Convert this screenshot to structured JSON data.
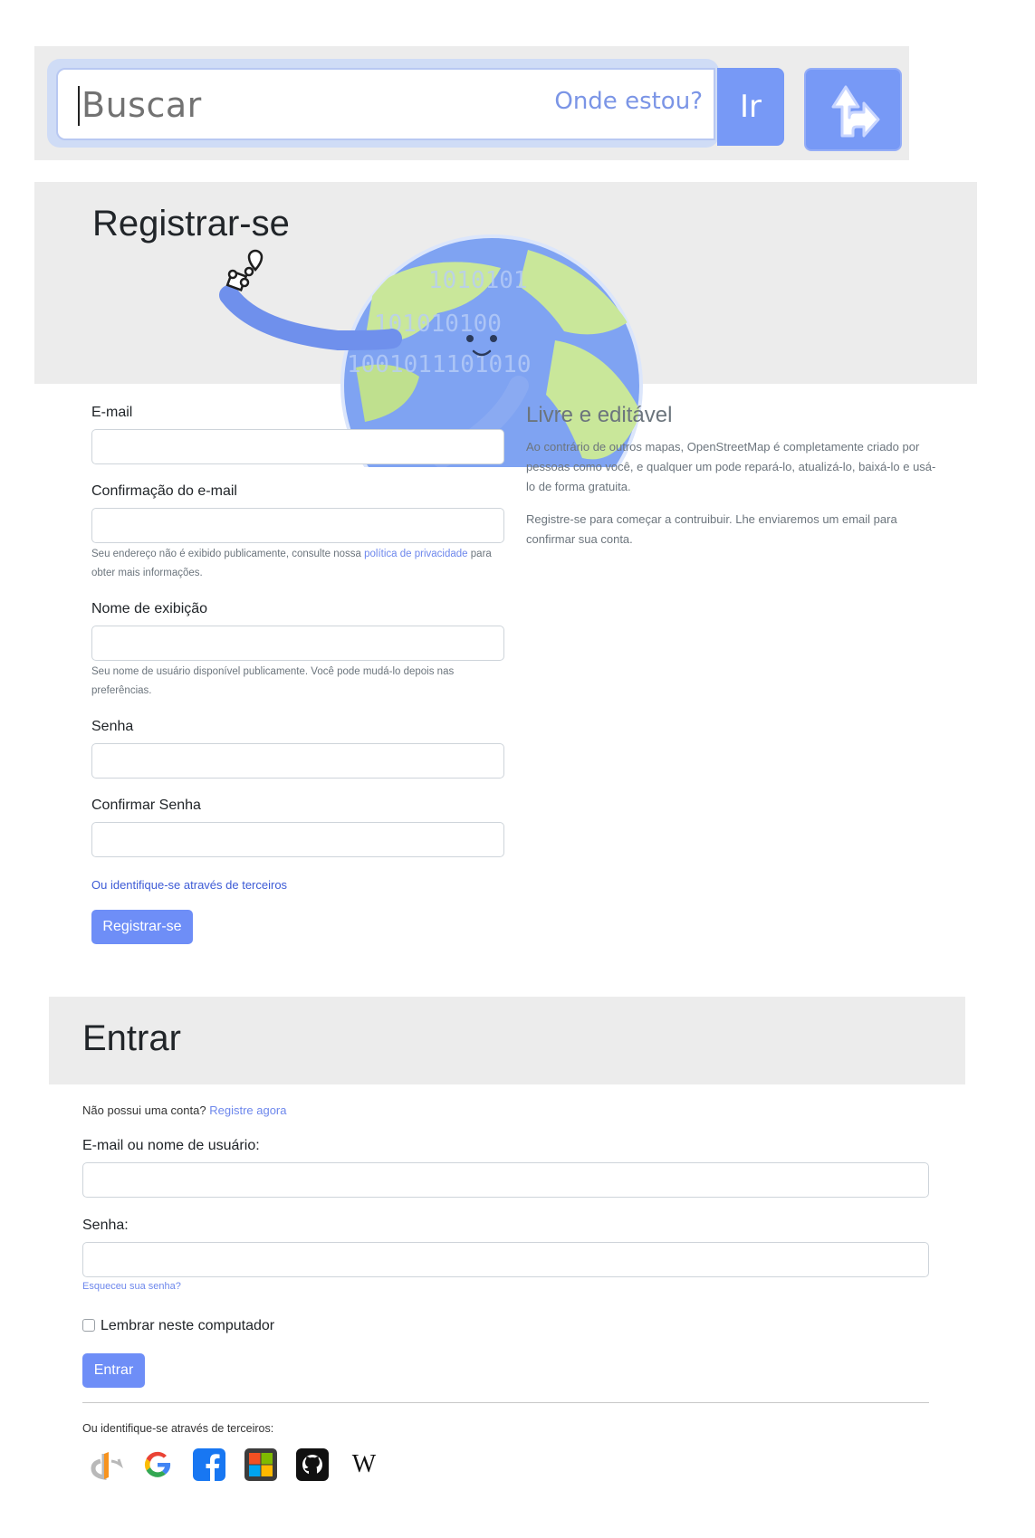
{
  "search": {
    "placeholder": "Buscar",
    "where_am_i": "Onde estou?",
    "go_label": "Ir",
    "directions_icon": "directions-arrow-icon"
  },
  "register": {
    "title": "Registrar-se",
    "illustration": "globe-mascot-icon",
    "email_label": "E-mail",
    "email_confirm_label": "Confirmação do e-mail",
    "email_help_prefix": "Seu endereço não é exibido publicamente, consulte nossa",
    "email_help_link": "política de privacidade",
    "email_help_suffix": "para obter mais informações.",
    "display_name_label": "Nome de exibição",
    "display_name_help": "Seu nome de usuário disponível publicamente. Você pode mudá-lo depois nas preferências.",
    "password_label": "Senha",
    "password_confirm_label": "Confirmar Senha",
    "third_party_link": "Ou identifique-se através de terceiros",
    "submit_label": "Registrar-se"
  },
  "sidebar": {
    "title": "Livre e editável",
    "paragraph1": "Ao contrário de outros mapas, OpenStreetMap é completamente criado por pessoas como você, e qualquer um pode repará-lo, atualizá-lo, baixá-lo e usá-lo de forma gratuita.",
    "paragraph2": "Registre-se para começar a contruibuir. Lhe enviaremos um email para confirmar sua conta."
  },
  "login": {
    "title": "Entrar",
    "no_account_text": "Não possui uma conta?",
    "register_now_link": "Registre agora",
    "username_label": "E-mail ou nome de usuário:",
    "password_label": "Senha:",
    "forgot_password_link": "Esqueceu sua senha?",
    "remember_label": "Lembrar neste computador",
    "submit_label": "Entrar",
    "third_party_text": "Ou identifique-se através de terceiros:",
    "providers": [
      "openid-icon",
      "google-icon",
      "facebook-icon",
      "microsoft-icon",
      "github-icon",
      "wikipedia-icon"
    ],
    "wikipedia_glyph": "W"
  },
  "colors": {
    "primary": "#6e8ef7",
    "link": "#6d87ec",
    "header_bg": "#ececec",
    "muted_text": "#6c757d"
  }
}
